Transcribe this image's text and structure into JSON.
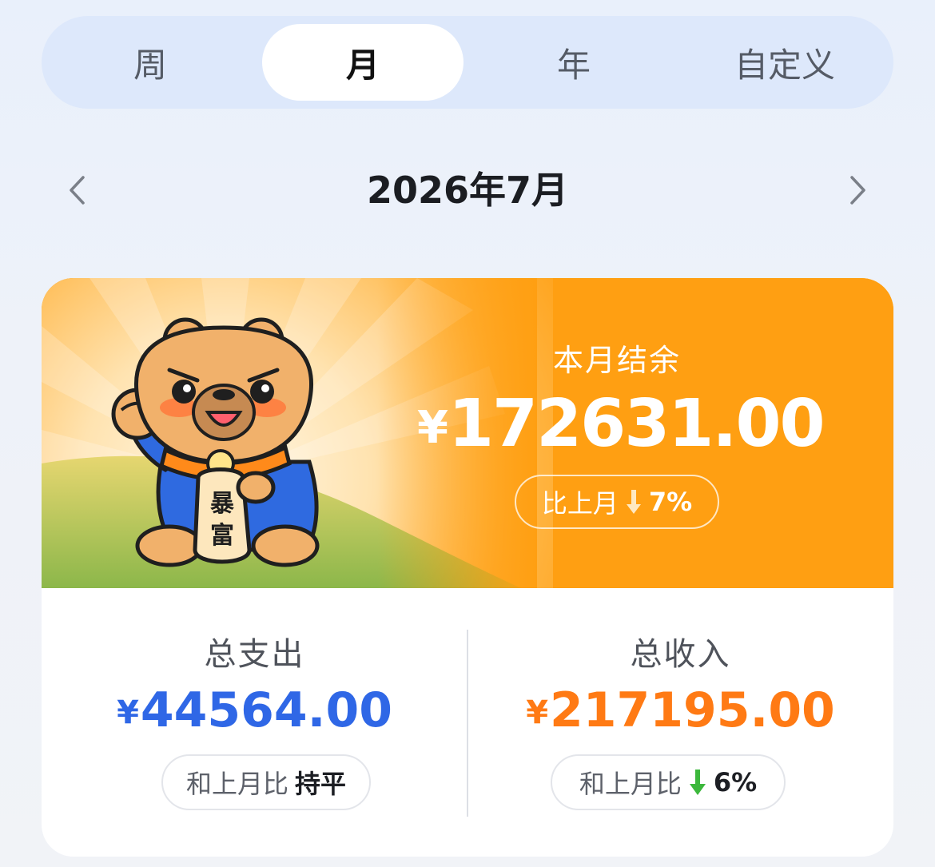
{
  "tabs": [
    {
      "label": "周",
      "active": false
    },
    {
      "label": "月",
      "active": true
    },
    {
      "label": "年",
      "active": false
    },
    {
      "label": "自定义",
      "active": false
    }
  ],
  "period": {
    "title": "2026年7月",
    "prev_icon": "chevron-left-icon",
    "next_icon": "chevron-right-icon"
  },
  "balance": {
    "label": "本月结余",
    "currency": "¥",
    "amount": "172631.00",
    "compare_label": "比上月",
    "compare_icon": "arrow-down-icon",
    "compare_value": "7%"
  },
  "mascot": {
    "sign_text": "暴富",
    "description_icon": "lucky-capybara-mascot"
  },
  "expense": {
    "label": "总支出",
    "currency": "¥",
    "amount": "44564.00",
    "compare_label": "和上月比",
    "compare_value": "持平"
  },
  "income": {
    "label": "总收入",
    "currency": "¥",
    "amount": "217195.00",
    "compare_label": "和上月比",
    "compare_icon": "arrow-down-icon",
    "compare_value": "6%"
  },
  "colors": {
    "accent_orange": "#ff9f12",
    "expense_blue": "#2f67e6",
    "income_orange": "#ff7a14",
    "trend_green": "#3cb83c"
  }
}
